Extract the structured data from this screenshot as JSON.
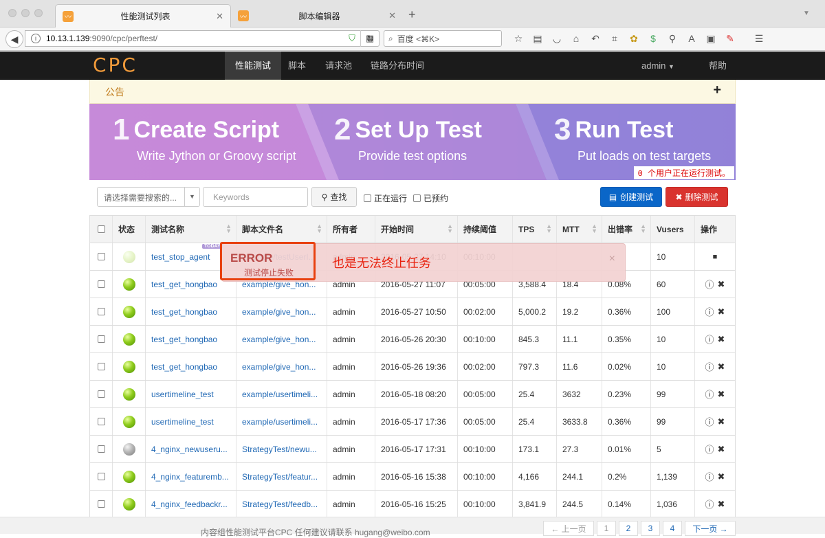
{
  "browser": {
    "tabs": [
      {
        "title": "性能测试列表",
        "close": "✕"
      },
      {
        "title": "脚本编辑器",
        "close": "✕"
      }
    ],
    "new_tab": "+",
    "url_host": "10.13.1.139",
    "url_path": ":9090/cpc/perftest/",
    "search_placeholder": "百度 <⌘K>"
  },
  "site": {
    "logo": "CPC",
    "nav": [
      "性能测试",
      "脚本",
      "请求池",
      "链路分布时间"
    ],
    "user": "admin",
    "help": "帮助"
  },
  "notice": {
    "label": "公告",
    "toggle": "+"
  },
  "banner": {
    "steps": [
      {
        "num": "1",
        "title": "Create Script",
        "sub": "Write Jython or Groovy script"
      },
      {
        "num": "2",
        "title": "Set Up Test",
        "sub": "Provide test options"
      },
      {
        "num": "3",
        "title": "Run Test",
        "sub": "Put loads on test targets"
      }
    ],
    "running": "0 个用户正在运行测试。"
  },
  "filters": {
    "select_placeholder": "请选择需要搜索的...",
    "keywords_placeholder": "Keywords",
    "search_btn": "查找",
    "running_label": "正在运行",
    "scheduled_label": "已预约",
    "create_btn": "创建测试",
    "delete_btn": "删除测试"
  },
  "table": {
    "headers": [
      "状态",
      "测试名称",
      "脚本文件名",
      "所有者",
      "开始时间",
      "持续阈值",
      "TPS",
      "MTT",
      "出错率",
      "Vusers",
      "操作"
    ],
    "rows": [
      {
        "status": "faded",
        "name": "test_stop_agent",
        "script": "example/testUserI...",
        "owner": "admin",
        "start": "2016-05-27 14:10",
        "duration": "00:10:00",
        "tps": "",
        "mtt": "",
        "err": "",
        "vusers": "10",
        "today": true,
        "ops": "stop"
      },
      {
        "status": "green",
        "name": "test_get_hongbao",
        "script": "example/give_hon...",
        "owner": "admin",
        "start": "2016-05-27 11:07",
        "duration": "00:05:00",
        "tps": "3,588.4",
        "mtt": "18.4",
        "err": "0.08%",
        "vusers": "60",
        "ops": "both"
      },
      {
        "status": "green",
        "name": "test_get_hongbao",
        "script": "example/give_hon...",
        "owner": "admin",
        "start": "2016-05-27 10:50",
        "duration": "00:02:00",
        "tps": "5,000.2",
        "mtt": "19.2",
        "err": "0.36%",
        "vusers": "100",
        "ops": "both"
      },
      {
        "status": "green",
        "name": "test_get_hongbao",
        "script": "example/give_hon...",
        "owner": "admin",
        "start": "2016-05-26 20:30",
        "duration": "00:10:00",
        "tps": "845.3",
        "mtt": "11.1",
        "err": "0.35%",
        "vusers": "10",
        "ops": "both"
      },
      {
        "status": "green",
        "name": "test_get_hongbao",
        "script": "example/give_hon...",
        "owner": "admin",
        "start": "2016-05-26 19:36",
        "duration": "00:02:00",
        "tps": "797.3",
        "mtt": "11.6",
        "err": "0.02%",
        "vusers": "10",
        "ops": "both"
      },
      {
        "status": "green",
        "name": "usertimeline_test",
        "script": "example/usertimeli...",
        "owner": "admin",
        "start": "2016-05-18 08:20",
        "duration": "00:05:00",
        "tps": "25.4",
        "mtt": "3632",
        "err": "0.23%",
        "vusers": "99",
        "ops": "both"
      },
      {
        "status": "green",
        "name": "usertimeline_test",
        "script": "example/usertimeli...",
        "owner": "admin",
        "start": "2016-05-17 17:36",
        "duration": "00:05:00",
        "tps": "25.4",
        "mtt": "3633.8",
        "err": "0.36%",
        "vusers": "99",
        "ops": "both"
      },
      {
        "status": "grey",
        "name": "4_nginx_newuseru...",
        "script": "StrategyTest/newu...",
        "owner": "admin",
        "start": "2016-05-17 17:31",
        "duration": "00:10:00",
        "tps": "173.1",
        "mtt": "27.3",
        "err": "0.01%",
        "vusers": "5",
        "ops": "both"
      },
      {
        "status": "green",
        "name": "4_nginx_featuremb...",
        "script": "StrategyTest/featur...",
        "owner": "admin",
        "start": "2016-05-16 15:38",
        "duration": "00:10:00",
        "tps": "4,166",
        "mtt": "244.1",
        "err": "0.2%",
        "vusers": "1,139",
        "ops": "both"
      },
      {
        "status": "green",
        "name": "4_nginx_feedbackr...",
        "script": "StrategyTest/feedb...",
        "owner": "admin",
        "start": "2016-05-16 15:25",
        "duration": "00:10:00",
        "tps": "3,841.9",
        "mtt": "244.5",
        "err": "0.14%",
        "vusers": "1,036",
        "ops": "both"
      }
    ],
    "today_badge": "TODAY"
  },
  "toast": {
    "title": "ERROR",
    "message": "测试停止失败",
    "close": "×"
  },
  "annotation": "也是无法终止任务",
  "footer": {
    "text": "内容组性能测试平台CPC 任何建议请联系 hugang@weibo.com",
    "prev": "← 上一页",
    "pages": [
      "1",
      "2",
      "3",
      "4"
    ],
    "next": "下一页 →"
  }
}
